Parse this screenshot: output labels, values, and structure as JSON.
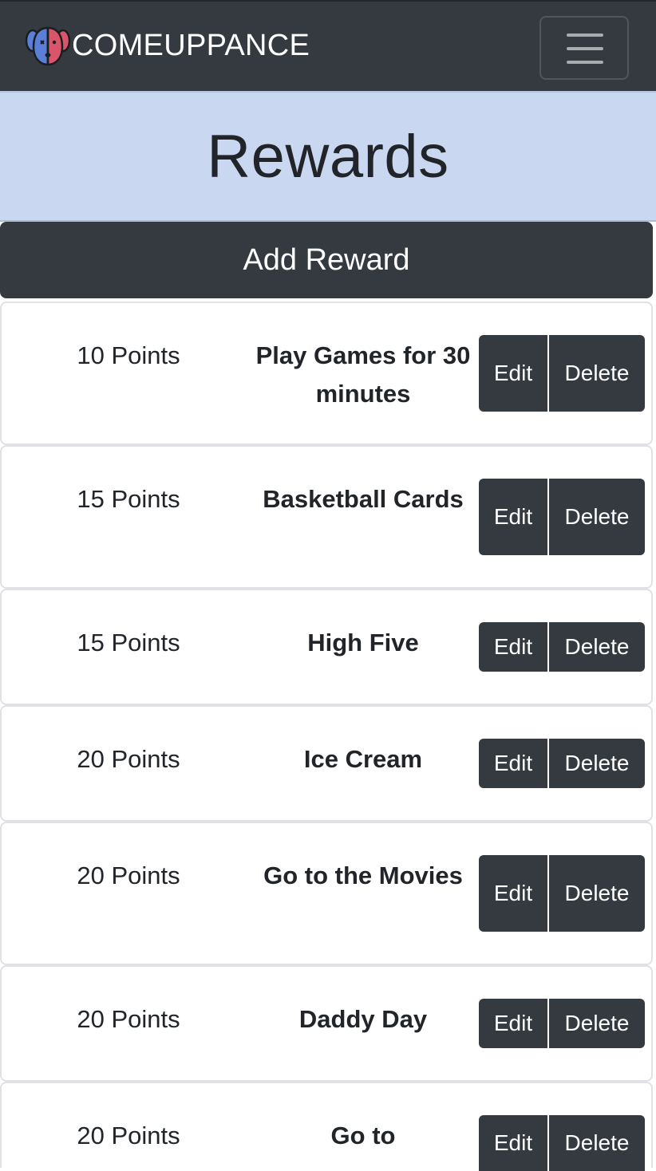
{
  "navbar": {
    "brand": "COMEUPPANCE",
    "logo_icon": "dog-face-icon",
    "menu_icon": "hamburger-menu-icon",
    "colors": {
      "dark": "#343a40",
      "logo_blue": "#5b7fd6",
      "logo_red": "#d9566a"
    }
  },
  "header": {
    "title": "Rewards",
    "background": "#c9d7f0"
  },
  "actions": {
    "add_label": "Add Reward"
  },
  "rewards": [
    {
      "points": "10 Points",
      "name": "Play Games for 30 minutes",
      "edit_label": "Edit",
      "delete_label": "Delete"
    },
    {
      "points": "15 Points",
      "name": "Basketball Cards",
      "edit_label": "Edit",
      "delete_label": "Delete"
    },
    {
      "points": "15 Points",
      "name": "High Five",
      "edit_label": "Edit",
      "delete_label": "Delete"
    },
    {
      "points": "20 Points",
      "name": "Ice Cream",
      "edit_label": "Edit",
      "delete_label": "Delete"
    },
    {
      "points": "20 Points",
      "name": "Go to the Movies",
      "edit_label": "Edit",
      "delete_label": "Delete"
    },
    {
      "points": "20 Points",
      "name": "Daddy Day",
      "edit_label": "Edit",
      "delete_label": "Delete"
    },
    {
      "points": "20 Points",
      "name": "Go to",
      "edit_label": "Edit",
      "delete_label": "Delete"
    }
  ]
}
